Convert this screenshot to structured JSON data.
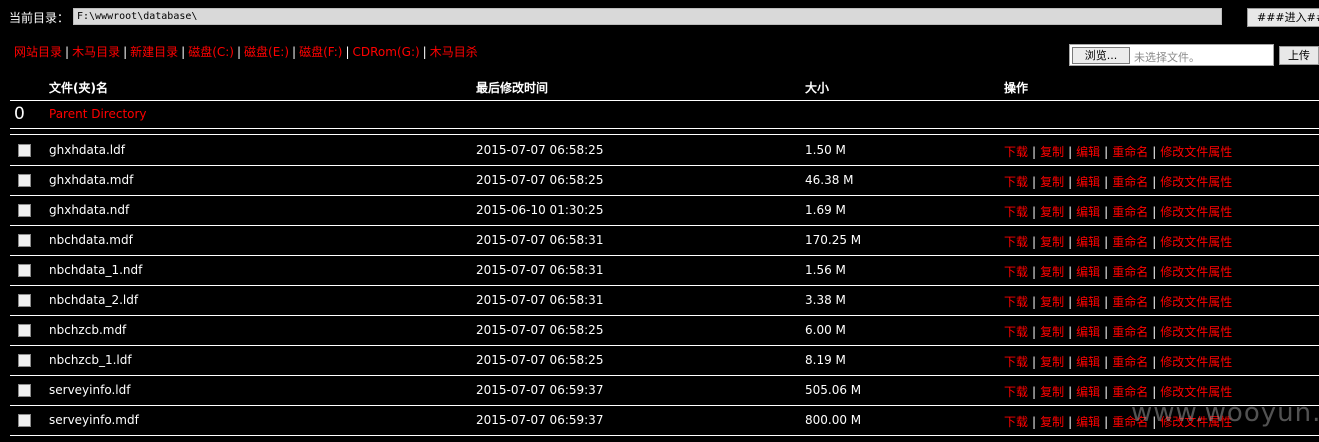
{
  "path_bar": {
    "label": "当前目录：",
    "path_value": "F:\\wwwroot\\database\\",
    "go_button": "###进入###"
  },
  "nav": {
    "links": [
      "网站目录",
      "木马目录",
      "新建目录",
      "磁盘(C:)",
      "磁盘(E:)",
      "磁盘(F:)",
      "CDRom(G:)",
      "木马目杀"
    ],
    "separator": "|"
  },
  "upload": {
    "browse_label": "浏览...",
    "file_status": "未选择文件。",
    "upload_label": "上传"
  },
  "table": {
    "headers": {
      "name": "文件(夹)名",
      "modified": "最后修改时间",
      "size": "大小",
      "actions": "操作"
    },
    "parent": {
      "index": "0",
      "label": "Parent Directory"
    },
    "action_labels": [
      "下载",
      "复制",
      "编辑",
      "重命名",
      "修改文件属性"
    ],
    "files": [
      {
        "name": "ghxhdata.ldf",
        "modified": "2015-07-07 06:58:25",
        "size": "1.50 M"
      },
      {
        "name": "ghxhdata.mdf",
        "modified": "2015-07-07 06:58:25",
        "size": "46.38 M"
      },
      {
        "name": "ghxhdata.ndf",
        "modified": "2015-06-10 01:30:25",
        "size": "1.69 M"
      },
      {
        "name": "nbchdata.mdf",
        "modified": "2015-07-07 06:58:31",
        "size": "170.25 M"
      },
      {
        "name": "nbchdata_1.ndf",
        "modified": "2015-07-07 06:58:31",
        "size": "1.56 M"
      },
      {
        "name": "nbchdata_2.ldf",
        "modified": "2015-07-07 06:58:31",
        "size": "3.38 M"
      },
      {
        "name": "nbchzcb.mdf",
        "modified": "2015-07-07 06:58:25",
        "size": "6.00 M"
      },
      {
        "name": "nbchzcb_1.ldf",
        "modified": "2015-07-07 06:58:25",
        "size": "8.19 M"
      },
      {
        "name": "serveyinfo.ldf",
        "modified": "2015-07-07 06:59:37",
        "size": "505.06 M"
      },
      {
        "name": "serveyinfo.mdf",
        "modified": "2015-07-07 06:59:37",
        "size": "800.00 M"
      }
    ]
  },
  "watermark": "www.wooyun.org",
  "colors": {
    "background": "#000000",
    "link": "#ff0000",
    "text": "#ffffff"
  }
}
